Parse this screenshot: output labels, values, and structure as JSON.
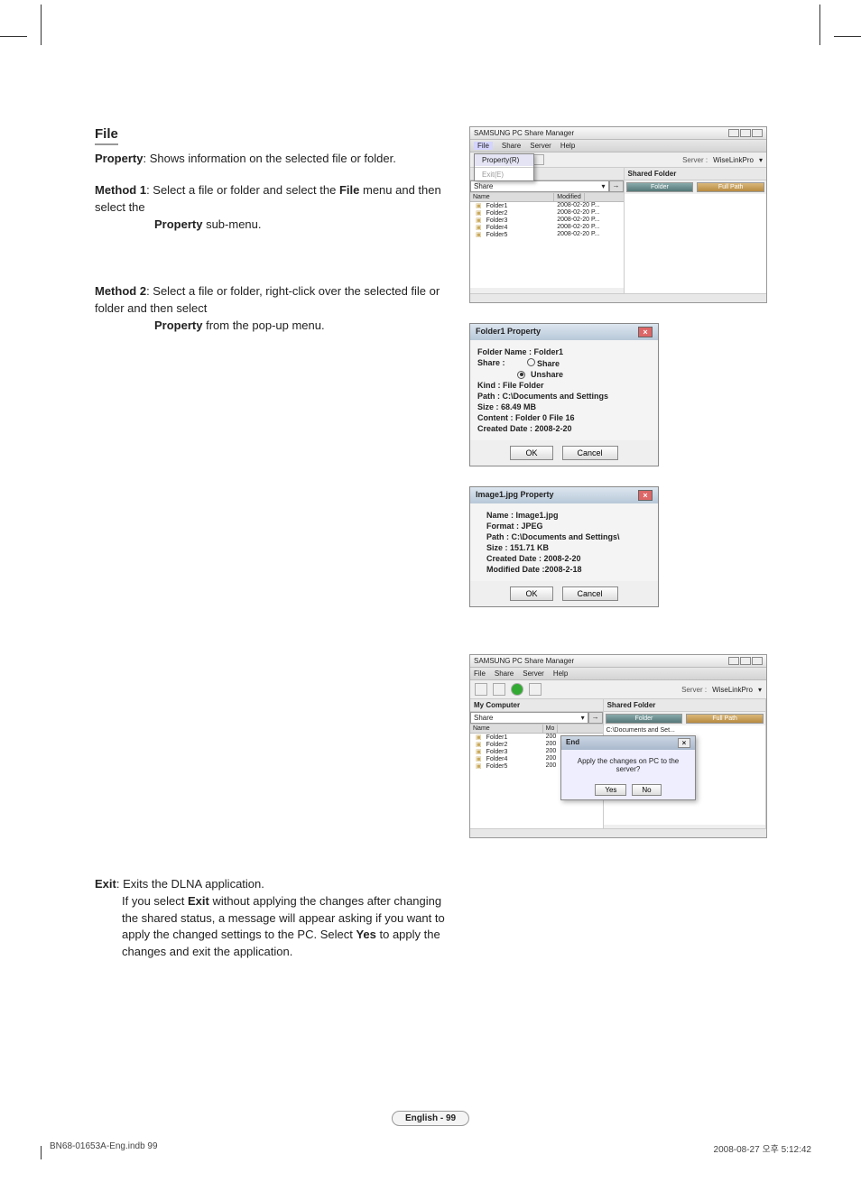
{
  "section_title": "File",
  "property_line_bold": "Property",
  "property_line_rest": ": Shows information on the selected file or folder.",
  "method1_label": "Method 1",
  "method1_text_a": ": Select a file or folder and select the ",
  "method1_text_file": "File",
  "method1_text_b": " menu and then select the ",
  "method1_text_prop": "Property",
  "method1_text_c": " sub-menu.",
  "method2_label": "Method 2",
  "method2_text_a": ": Select a file or folder, right-click over the selected file or folder and then select ",
  "method2_text_prop": "Property",
  "method2_text_b": " from the pop-up menu.",
  "exit_label": "Exit",
  "exit_text_a": ": Exits the DLNA application.",
  "exit_body_a": "If you select ",
  "exit_body_exit": "Exit",
  "exit_body_b": " without applying the changes after changing the shared status, a message will appear asking if you want to apply the changed settings to the PC. Select ",
  "exit_body_yes": "Yes",
  "exit_body_c": " to apply the changes and exit the application.",
  "app_title": "SAMSUNG PC Share Manager",
  "menu": {
    "file": "File",
    "share": "Share",
    "server": "Server",
    "help": "Help"
  },
  "file_menu": {
    "property": "Property(R)",
    "exit": "Exit(E)"
  },
  "server_label": "Server :",
  "server_value": "WiseLinkPro",
  "panel": {
    "mycomputer": "My Computer",
    "shared": "Shared Folder",
    "share_dd": "Share",
    "folder_btn": "Folder",
    "fullpath_btn": "Full Path"
  },
  "cols": {
    "name": "Name",
    "modified": "Modified"
  },
  "rows": [
    {
      "name": "Folder1",
      "mod": "2008-02-20 P..."
    },
    {
      "name": "Folder2",
      "mod": "2008-02-20 P..."
    },
    {
      "name": "Folder3",
      "mod": "2008-02-20 P..."
    },
    {
      "name": "Folder4",
      "mod": "2008-02-20 P..."
    },
    {
      "name": "Folder5",
      "mod": "2008-02-20 P..."
    }
  ],
  "rows2": [
    {
      "name": "Folder1",
      "mod": "200"
    },
    {
      "name": "Folder2",
      "mod": "200"
    },
    {
      "name": "Folder3",
      "mod": "200"
    },
    {
      "name": "Folder4",
      "mod": "200"
    },
    {
      "name": "Folder5",
      "mod": "200"
    }
  ],
  "folder_prop": {
    "title": "Folder1  Property",
    "name": "Folder Name : Folder1",
    "share_label": "Share :",
    "share_opt": "Share",
    "unshare_opt": "Unshare",
    "kind": "Kind : File Folder",
    "path": "Path :    C:\\Documents and Settings",
    "size": "Size : 68.49 MB",
    "content": "Content : Folder  0 File  16",
    "created": "Created Date : 2008-2-20",
    "ok": "OK",
    "cancel": "Cancel"
  },
  "image_prop": {
    "title": "Image1.jpg  Property",
    "name": "Name : Image1.jpg",
    "format": "Format : JPEG",
    "path": "Path :    C:\\Documents and Settings\\",
    "size": "Size : 151.71 KB",
    "created": "Created Date : 2008-2-20",
    "modified": "Modified Date  :2008-2-18",
    "ok": "OK",
    "cancel": "Cancel"
  },
  "end_dialog": {
    "title": "End",
    "msg": "Apply the changes on PC to the server?",
    "yes": "Yes",
    "no": "No"
  },
  "shared_right_col": "C:\\Documents and Set...",
  "page_badge": "English - 99",
  "footer_left": "BN68-01653A-Eng.indb   99",
  "footer_right": "2008-08-27   오후 5:12:42"
}
